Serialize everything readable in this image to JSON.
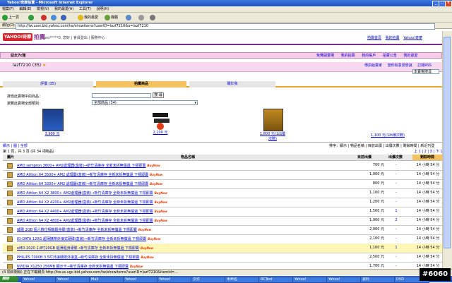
{
  "window": {
    "title": "Yahoo!奇摩拍賣 - Microsoft Internet Explorer"
  },
  "menu": [
    "檔案(F)",
    "編輯(E)",
    "檢視(V)",
    "我的最愛(A)",
    "工具(T)",
    "說明(H)"
  ],
  "toolbar": {
    "back": "上一頁",
    "favorites": "我的最愛",
    "media": "媒體"
  },
  "address": {
    "label": "網址(D)",
    "url": "http://tw.user.bid.yahoo.com/tw/showitems?userID=lazf7210&u=lazf7210"
  },
  "header": {
    "logo": "YAHOO!奇摩",
    "section": "拍賣",
    "user_text": "pro*****0, 您好 | 會員登出 | 服務中心",
    "right_links": [
      "拍賣首頁",
      "我的拍賣",
      "Yahoo!奇摩"
    ]
  },
  "store": {
    "name": "亞太7c館",
    "nav": [
      "免費開賣場",
      "我的拍賣",
      "我的帳戶",
      "拍賣公告",
      "我的最愛"
    ],
    "seller": "lazf7210 (35)",
    "actions": [
      "傳訊給賣家",
      "當你有意見想說",
      "訂閱RSS"
    ],
    "category_select": "本賣場搜尋"
  },
  "tabs": [
    "評價 (35)",
    "拍賣商品",
    "關於我"
  ],
  "search": {
    "label": "搜尋此賣場中的商品：",
    "button": "搜 尋",
    "cat_label": "瀏覽此賣場全部類別：",
    "cat_value": "全部商品 (34)"
  },
  "featured": [
    {
      "name": "顯示卡",
      "price": "3,900 元"
    },
    {
      "name": "記憶體",
      "price": "2,100 元"
    },
    {
      "name": "顯示卡",
      "price": "1,800 元(1出價次數)"
    },
    {
      "name": "",
      "price": "1,100 元(1出價次數)"
    }
  ],
  "list_bar": {
    "left": "顯示 | 圖 | 全部",
    "right": "排序：顯示 | 物品名稱 | 目前出價 | 出價次數 | 剩餘時間 | 新近刊登"
  },
  "pagination": {
    "left": "第 1 頁，共 3 頁 (共 34 項物品)",
    "right": "上 1 | 2 | 3 | 下 1"
  },
  "table": {
    "headers": [
      "圖片",
      "物品名稱",
      "目前出價",
      "出價次數",
      "剩餘時間"
    ],
    "rows": [
      {
        "title": "AMD sempron 3600+ AM2處理器(盒裝)→新竹清庫存 全新未拆無償還 下標即賣",
        "bn": "BuyNow",
        "price": "700 元",
        "bids": "-",
        "time": "14 小時 54 分"
      },
      {
        "title": "AMD Athlon 64 3500+ AM2 處理器(盒裝)→新竹清庫存 全新未拆無償還 下標即賣",
        "bn": "BuyNow",
        "price": "1,000 元",
        "bids": "-",
        "time": "14 小時 54 分"
      },
      {
        "title": "AMD Athlon 64 3200+ AM2 處理器(盒裝)→新竹清庫存 全新未拆無償還 下標即賣",
        "bn": "BuyNow",
        "price": "800 元",
        "bids": "-",
        "time": "14 小時 54 分"
      },
      {
        "title": "AMD Athlon 64 X2 3800+ AM2處理器(盒裝)→新竹清庫存 全新未拆無償還 下標即賣",
        "bn": "BuyNow",
        "price": "1,100 元",
        "bids": "-",
        "time": "14 小時 54 分"
      },
      {
        "title": "AMD Athlon 64 X2 4200+ AM2處理器(盒裝)→新竹清庫存 全新未拆無償還 下標即賣",
        "bn": "BuyNow",
        "price": "1,200 元",
        "bids": "-",
        "time": "14 小時 54 分"
      },
      {
        "title": "AMD Athlon 64 X2 4400+ AM2處理器(盒裝)→新竹清庫存 全新未拆無償還 下標即賣",
        "bn": "BuyNow",
        "price": "1,500 元",
        "bids": "1",
        "time": "14 小時 54 分"
      },
      {
        "title": "AMD Athlon 64 X2 4800+ AM2處理器(盒裝)→新竹清庫存 全新未拆無償還 下標即賣",
        "bn": "BuyNow",
        "price": "1,900 元",
        "bids": "2",
        "time": "14 小時 54 分"
      },
      {
        "title": "威剛 2GB 個人數位相機隨身碟(盒裝)→新竹清庫存 全新未拆無償還 下標即賣",
        "bn": "BuyNow",
        "price": "2,000 元",
        "bids": "-",
        "time": "14 小時 54 分"
      },
      {
        "title": "IO-DATA 120G 超薄攜帶外接式硬碟(盒裝)→新竹清庫存 全新未拆無償還 下標即賣",
        "bn": "BuyNow",
        "price": "2,100 元",
        "bids": "-",
        "time": "14 小時 54 分"
      },
      {
        "title": "eMD-1020 1.8吋20GB 超薄隨身硬碟→新竹清庫存 全新未拆無償還 下標即賣",
        "bn": "BuyNow",
        "price": "1,100 元",
        "bids": "1",
        "time": "14 小時 54 分"
      },
      {
        "title": "PHILIPS 7000B 3.5吋外接硬碟外接盒→新竹清庫存 全新未拆無償還 下標即賣",
        "bn": "BuyNow",
        "price": "2,500 元",
        "bids": "-",
        "time": "14 小時 54 分"
      },
      {
        "title": "NVIDIA X1250 256MB 顯示卡→新竹清庫存 全新未拆無償還 下標即賣",
        "bn": "BuyNow",
        "price": "1,700 元",
        "bids": "-",
        "time": "14 小時 54 分"
      }
    ]
  },
  "status": {
    "text": "(4 項目剩餘) 正在下載網頁 http://tw.us.ugc.bid.yahoo.com/tw/showitems?userID=lazf7210&itemId=..."
  },
  "taskbar": {
    "start": "開始",
    "tasks": [
      "Yahoo!",
      "Yahoo!",
      "Mail",
      "Yahoo!",
      "Yahoo!",
      "文件",
      "未命名",
      "RCTest",
      "Yahoo!",
      "Yahoo!",
      "資料",
      "DVD"
    ],
    "badge": "#6060"
  },
  "colors": {
    "accent": "#7b2b8a",
    "tab_active": "#f4c35f",
    "link": "#0000cc"
  }
}
